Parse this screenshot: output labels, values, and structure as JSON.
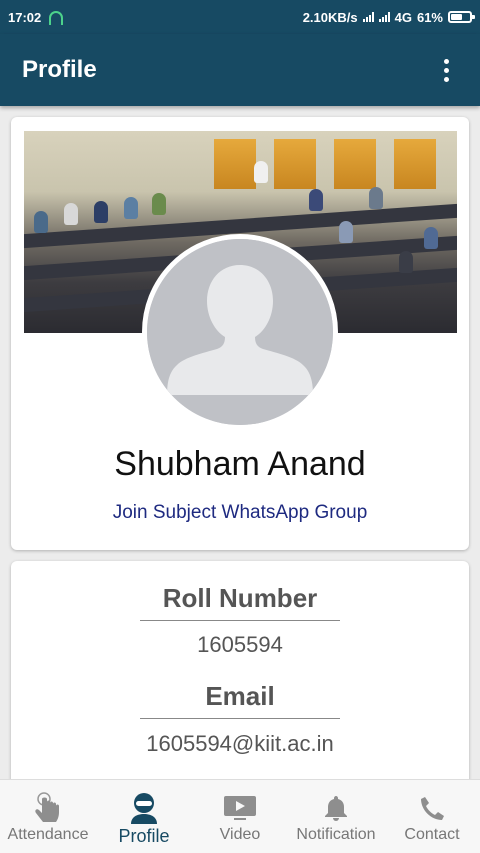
{
  "status_bar": {
    "time": "17:02",
    "network_speed": "2.10KB/s",
    "network_type": "4G",
    "battery": "61%",
    "battery_level": 0.61
  },
  "app_bar": {
    "title": "Profile",
    "overflow_icon": "more-vert-icon"
  },
  "profile": {
    "name": "Shubham Anand",
    "whatsapp_link": "Join Subject WhatsApp Group"
  },
  "details": {
    "roll_label": "Roll Number",
    "roll_value": "1605594",
    "email_label": "Email",
    "email_value": "1605594@kiit.ac.in"
  },
  "bottom_nav": {
    "items": [
      {
        "label": "Attendance",
        "icon": "touch-hand-icon"
      },
      {
        "label": "Profile",
        "icon": "person-icon"
      },
      {
        "label": "Video",
        "icon": "video-icon"
      },
      {
        "label": "Notification",
        "icon": "bell-icon"
      },
      {
        "label": "Contact",
        "icon": "phone-icon"
      }
    ],
    "active_index": 1
  },
  "colors": {
    "primary": "#174a63",
    "link": "#1e2a80"
  }
}
